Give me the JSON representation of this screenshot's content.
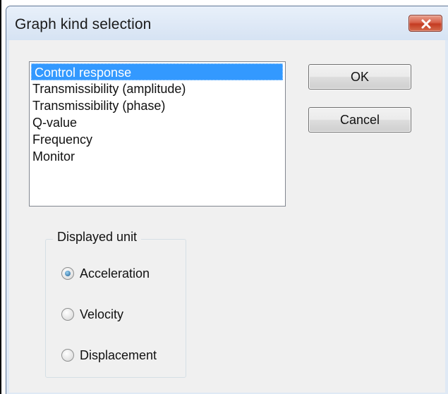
{
  "window": {
    "title": "Graph kind selection"
  },
  "graph_list": {
    "items": [
      "Control response",
      "Transmissibility (amplitude)",
      "Transmissibility (phase)",
      "Q-value",
      "Frequency",
      "Monitor"
    ],
    "selected": "Control response"
  },
  "buttons": {
    "ok": "OK",
    "cancel": "Cancel"
  },
  "displayed_unit": {
    "legend": "Displayed unit",
    "options": [
      "Acceleration",
      "Velocity",
      "Displacement"
    ],
    "selected": "Acceleration"
  },
  "icons": {
    "close": "close-icon"
  },
  "colors": {
    "selection": "#3399ff",
    "close_button": "#c43b21"
  }
}
